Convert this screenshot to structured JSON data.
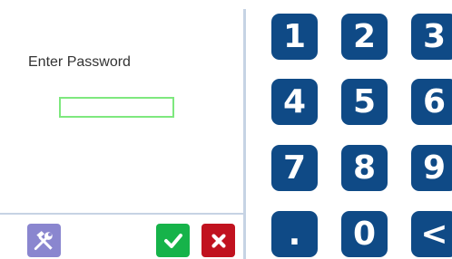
{
  "prompt_label": "Enter Password",
  "password_value": "",
  "keypad": [
    "1",
    "2",
    "3",
    "4",
    "5",
    "6",
    "7",
    "8",
    "9",
    ".",
    "0",
    "<"
  ],
  "colors": {
    "key_bg": "#0f4a86",
    "ok_bg": "#16b34a",
    "cancel_bg": "#c1121f",
    "settings_bg": "#8a86cf",
    "field_border": "#7ee87e"
  },
  "icons": {
    "settings": "tools-icon",
    "ok": "checkmark-icon",
    "cancel": "close-icon"
  }
}
